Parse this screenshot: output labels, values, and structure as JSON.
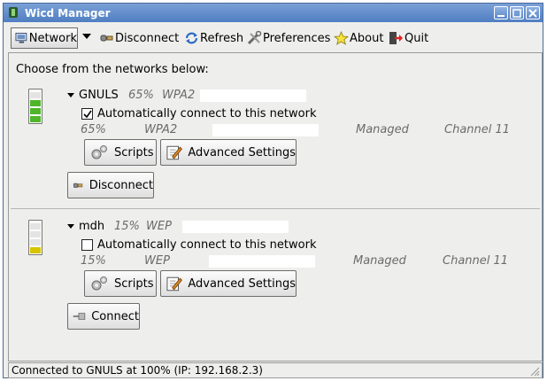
{
  "window": {
    "title": "Wicd Manager"
  },
  "toolbar": {
    "network_label": "Network",
    "disconnect_label": "Disconnect",
    "refresh_label": "Refresh",
    "preferences_label": "Preferences",
    "about_label": "About",
    "quit_label": "Quit"
  },
  "main": {
    "intro": "Choose from the networks below:"
  },
  "networks": [
    {
      "name": "GNULS",
      "strength": "65%",
      "encryption": "WPA2",
      "auto_connect_label": "Automatically connect to this network",
      "auto_connect": true,
      "info_strength": "65%",
      "info_encryption": "WPA2",
      "mode": "Managed",
      "channel": "Channel 11",
      "scripts_label": "Scripts",
      "advanced_label": "Advanced Settings",
      "action_label": "Disconnect",
      "signal_level": 0.65,
      "signal_color": "#4fb52b"
    },
    {
      "name": "mdh",
      "strength": "15%",
      "encryption": "WEP",
      "auto_connect_label": "Automatically connect to this network",
      "auto_connect": false,
      "info_strength": "15%",
      "info_encryption": "WEP",
      "mode": "Managed",
      "channel": "Channel 11",
      "scripts_label": "Scripts",
      "advanced_label": "Advanced Settings",
      "action_label": "Connect",
      "signal_level": 0.15,
      "signal_color": "#d6c400"
    }
  ],
  "statusbar": {
    "text": "Connected to GNULS at 100% (IP: 192.168.2.3)"
  },
  "colors": {
    "title_bar": "#5b88c9",
    "signal_strong": "#4fb52b",
    "signal_weak": "#d6c400"
  }
}
